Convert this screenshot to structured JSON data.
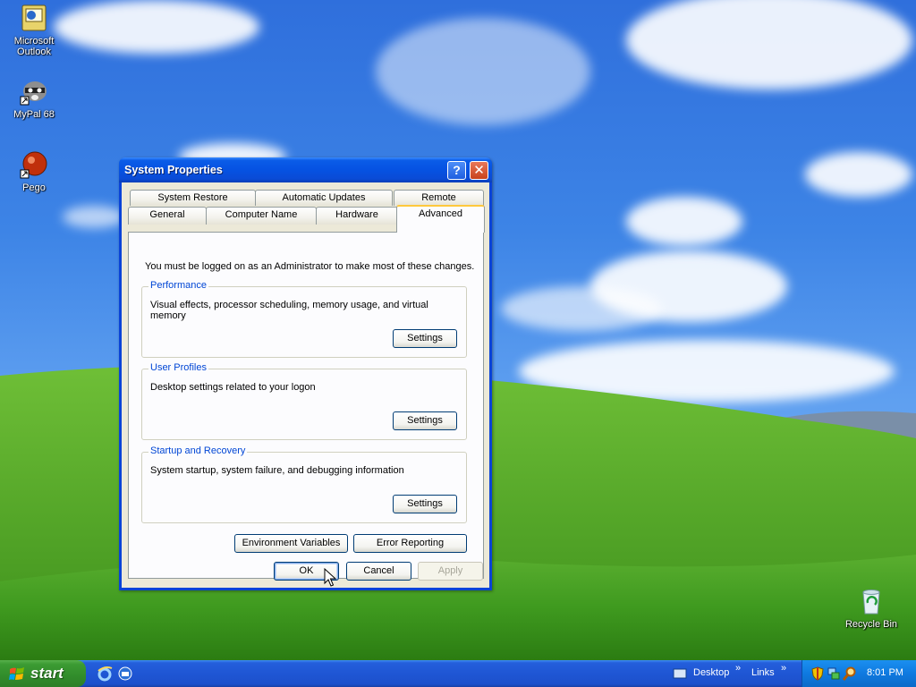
{
  "desktop": {
    "icons": [
      {
        "label": "Microsoft\nOutlook",
        "icon": "outlook-icon"
      },
      {
        "label": "MyPal 68",
        "icon": "mypal-raccoon-icon"
      },
      {
        "label": "Pego",
        "icon": "pego-ball-icon"
      },
      {
        "label": "Recycle Bin",
        "icon": "recycle-bin-icon"
      }
    ]
  },
  "window": {
    "title": "System Properties",
    "help_button": "?",
    "close_button": "✕",
    "tabs_row1": [
      "System Restore",
      "Automatic Updates",
      "Remote"
    ],
    "tabs_row2": [
      "General",
      "Computer Name",
      "Hardware",
      "Advanced"
    ],
    "active_tab": "Advanced",
    "admin_note": "You must be logged on as an Administrator to make most of these changes.",
    "groups": [
      {
        "title": "Performance",
        "description": "Visual effects, processor scheduling, memory usage, and virtual memory",
        "button": "Settings"
      },
      {
        "title": "User Profiles",
        "description": "Desktop settings related to your logon",
        "button": "Settings"
      },
      {
        "title": "Startup and Recovery",
        "description": "System startup, system failure, and debugging information",
        "button": "Settings"
      }
    ],
    "environment_variables_button": "Environment Variables",
    "error_reporting_button": "Error Reporting",
    "ok_button": "OK",
    "cancel_button": "Cancel",
    "apply_button": "Apply"
  },
  "taskbar": {
    "start_label": "start",
    "quick_launch": [
      "internet-explorer-icon",
      "outlook-express-icon"
    ],
    "desktop_toolbar": "Desktop",
    "links_toolbar": "Links",
    "chevron": "»",
    "clock": "8:01 PM",
    "tray_icons": [
      "security-shield-icon",
      "network-icon",
      "search-icon"
    ]
  },
  "colors": {
    "title_bar": "#0a5ce8",
    "active_tab_accent": "#ffc83c",
    "groupbox_title": "#0046d5",
    "start_button": "#3c9b33"
  }
}
